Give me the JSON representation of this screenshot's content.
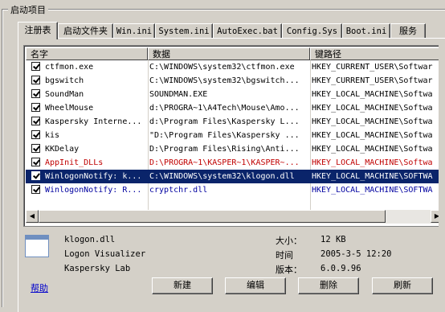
{
  "group_title": "启动项目",
  "tabs": [
    "注册表",
    "启动文件夹",
    "Win.ini",
    "System.ini",
    "AutoExec.bat",
    "Config.Sys",
    "Boot.ini",
    "服务"
  ],
  "columns": [
    "名字",
    "数据",
    "键路径"
  ],
  "rows": [
    {
      "name": "ctfmon.exe",
      "data": "C:\\WINDOWS\\system32\\ctfmon.exe",
      "path": "HKEY_CURRENT_USER\\Softwar",
      "checked": true,
      "style": "normal"
    },
    {
      "name": "bgswitch",
      "data": "C:\\WINDOWS\\system32\\bgswitch...",
      "path": "HKEY_CURRENT_USER\\Softwar",
      "checked": true,
      "style": "normal"
    },
    {
      "name": "SoundMan",
      "data": "SOUNDMAN.EXE",
      "path": "HKEY_LOCAL_MACHINE\\Softwa",
      "checked": true,
      "style": "normal"
    },
    {
      "name": "WheelMouse",
      "data": "d:\\PROGRA~1\\A4Tech\\Mouse\\Amo...",
      "path": "HKEY_LOCAL_MACHINE\\Softwa",
      "checked": true,
      "style": "normal"
    },
    {
      "name": "Kaspersky Interne...",
      "data": "d:\\Program Files\\Kaspersky L...",
      "path": "HKEY_LOCAL_MACHINE\\Softwa",
      "checked": true,
      "style": "normal"
    },
    {
      "name": "kis",
      "data": "\"D:\\Program Files\\Kaspersky ...",
      "path": "HKEY_LOCAL_MACHINE\\Softwa",
      "checked": true,
      "style": "normal"
    },
    {
      "name": "KKDelay",
      "data": "D:\\Program Files\\Rising\\Anti...",
      "path": "HKEY_LOCAL_MACHINE\\Softwa",
      "checked": true,
      "style": "normal"
    },
    {
      "name": "AppInit_DLLs",
      "data": "D:\\PROGRA~1\\KASPER~1\\KASPER~...",
      "path": "HKEY_LOCAL_MACHINE\\Softwa",
      "checked": true,
      "style": "red"
    },
    {
      "name": "WinlogonNotify: k...",
      "data": "C:\\WINDOWS\\system32\\klogon.dll",
      "path": "HKEY_LOCAL_MACHINE\\SOFTWA",
      "checked": true,
      "style": "selected"
    },
    {
      "name": "WinlogonNotify: R...",
      "data": "cryptchr.dll",
      "path": "HKEY_LOCAL_MACHINE\\SOFTWA",
      "checked": true,
      "style": "blue"
    }
  ],
  "details": {
    "file": "klogon.dll",
    "description": "Logon Visualizer",
    "company": "Kaspersky Lab",
    "size_label": "大小：",
    "size": "12 KB",
    "time_label": "时间",
    "time": "2005-3-5 12:20",
    "version_label": "版本：",
    "version": "6.0.9.96"
  },
  "help_link": "帮助",
  "buttons": {
    "new": "新建",
    "edit": "编辑",
    "delete": "删除",
    "refresh": "刷新"
  },
  "colors": {
    "selection": "#0a246a",
    "red_text": "#c00000",
    "blue_text": "#0000a0",
    "face": "#d4d0c8"
  }
}
